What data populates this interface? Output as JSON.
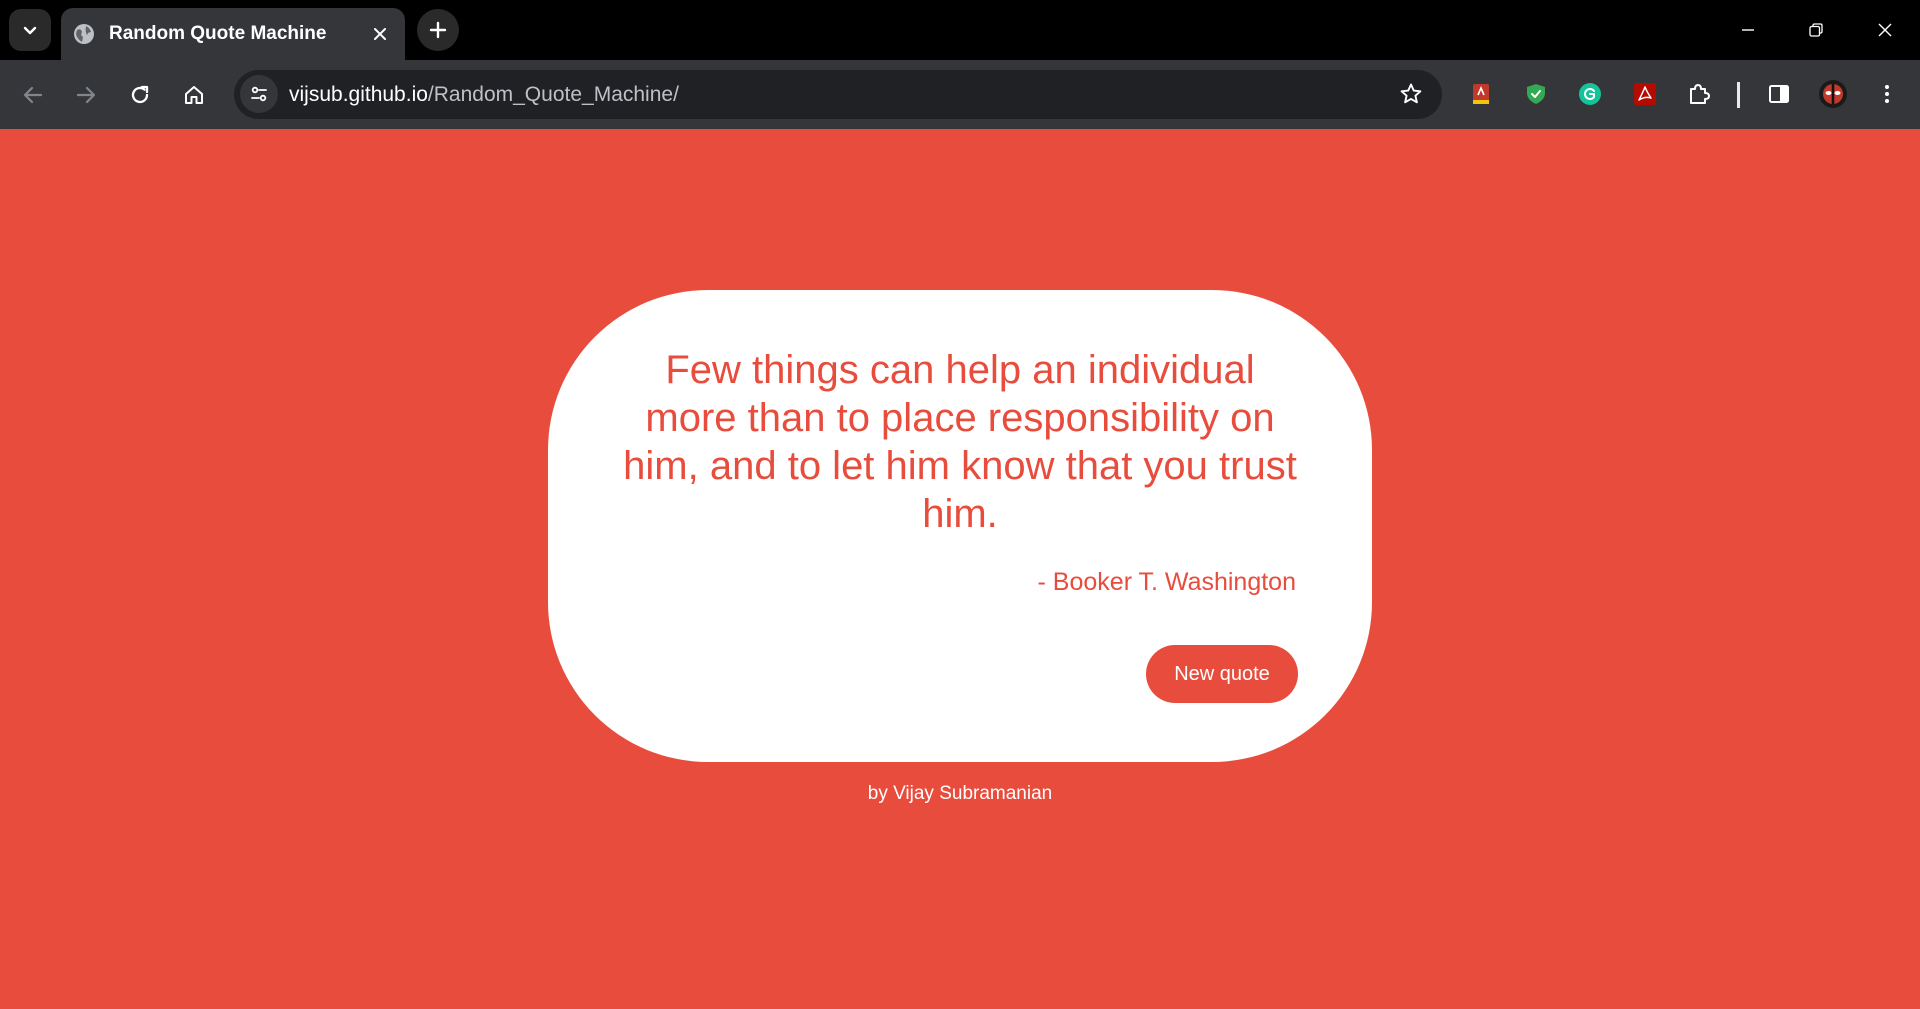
{
  "browser": {
    "tab_title": "Random Quote Machine",
    "url_host": "vijsub.github.io",
    "url_path": "/Random_Quote_Machine/",
    "icons": {
      "tab_search": "chevron-down-icon",
      "favicon": "globe-icon",
      "tab_close": "close-icon",
      "new_tab": "plus-icon",
      "minimize": "minimize-icon",
      "restore": "restore-icon",
      "close_window": "close-icon",
      "back": "arrow-left-icon",
      "forward": "arrow-right-icon",
      "reload": "reload-icon",
      "home": "home-icon",
      "site_info": "tune-icon",
      "bookmark": "star-icon",
      "extensions": [
        "red-book-extension-icon",
        "green-shield-extension-icon",
        "grammarly-extension-icon",
        "acrobat-extension-icon",
        "puzzle-icon"
      ],
      "side_panel": "side-panel-icon",
      "profile": "avatar-icon",
      "menu": "kebab-menu-icon"
    }
  },
  "page": {
    "background_color": "#e74c3c",
    "quote": "Few things can help an individual more than to place responsibility on him, and to let him know that you trust him.",
    "author": "- Booker T. Washington",
    "new_quote_label": "New quote",
    "credit": "by Vijay Subramanian"
  }
}
